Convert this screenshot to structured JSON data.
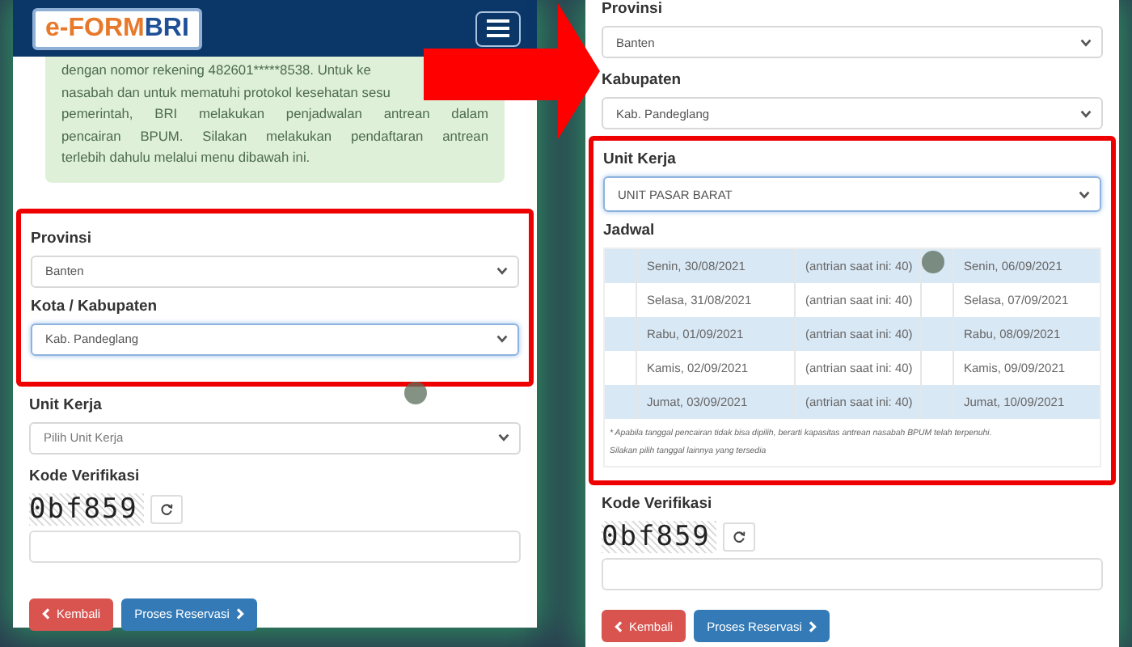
{
  "left_screen": {
    "header": {
      "logo": {
        "part_1": "e-FORM",
        "part_2": "BRI"
      }
    },
    "notice_lines": [
      "dengan nomor rekening 482601*****8538. Untuk ke",
      "nasabah dan untuk mematuhi protokol kesehatan sesu",
      "pemerintah, BRI melakukan penjadwalan antrean dalam",
      "pencairan BPUM. Silakan melakukan pendaftaran antrean",
      "terlebih dahulu melalui menu dibawah ini."
    ],
    "sections": [
      {
        "kind": "select",
        "label": "Provinsi",
        "value": "Banten",
        "focused": false,
        "highlighted": true
      },
      {
        "kind": "select",
        "label": "Kota / Kabupaten",
        "value": "Kab. Pandeglang",
        "focused": true,
        "highlighted": true
      },
      {
        "kind": "select",
        "label": "Unit Kerja",
        "placeholder": "Pilih Unit Kerja",
        "focused": false,
        "highlighted": false
      }
    ],
    "verification": {
      "label": "Kode Verifikasi",
      "captcha": "0bf859"
    },
    "buttons": [
      {
        "kind": "back",
        "label": "Kembali"
      },
      {
        "kind": "submit",
        "label": "Proses Reservasi"
      }
    ]
  },
  "right_screen": {
    "sections": [
      {
        "kind": "select",
        "label": "Provinsi",
        "value": "Banten",
        "focused": false,
        "highlighted": false
      },
      {
        "kind": "select",
        "label": "Kabupaten",
        "value": "Kab. Pandeglang",
        "focused": false,
        "highlighted": false
      },
      {
        "kind": "select",
        "label": "Unit Kerja",
        "value": "UNIT PASAR BARAT",
        "focused": true,
        "highlighted": true
      },
      {
        "kind": "schedule",
        "label": "Jadwal",
        "highlighted": true,
        "rows": [
          {
            "date_1": "Senin, 30/08/2021",
            "queue": "(antrian saat ini: 40)",
            "date_2": "Senin, 06/09/2021"
          },
          {
            "date_1": "Selasa, 31/08/2021",
            "queue": "(antrian saat ini: 40)",
            "date_2": "Selasa, 07/09/2021"
          },
          {
            "date_1": "Rabu, 01/09/2021",
            "queue": "(antrian saat ini: 40)",
            "date_2": "Rabu, 08/09/2021"
          },
          {
            "date_1": "Kamis, 02/09/2021",
            "queue": "(antrian saat ini: 40)",
            "date_2": "Kamis, 09/09/2021"
          },
          {
            "date_1": "Jumat, 03/09/2021",
            "queue": "(antrian saat ini: 40)",
            "date_2": "Jumat, 10/09/2021"
          }
        ],
        "notes": [
          "* Apabila tanggal pencairan tidak bisa dipilih, berarti kapasitas antrean nasabah BPUM telah terpenuhi.",
          "Silakan pilih tanggal lainnya yang tersedia"
        ]
      }
    ],
    "verification": {
      "label": "Kode Verifikasi",
      "captcha": "0bf859"
    },
    "buttons": [
      {
        "kind": "back",
        "label": "Kembali"
      },
      {
        "kind": "submit",
        "label": "Proses Reservasi"
      }
    ]
  }
}
